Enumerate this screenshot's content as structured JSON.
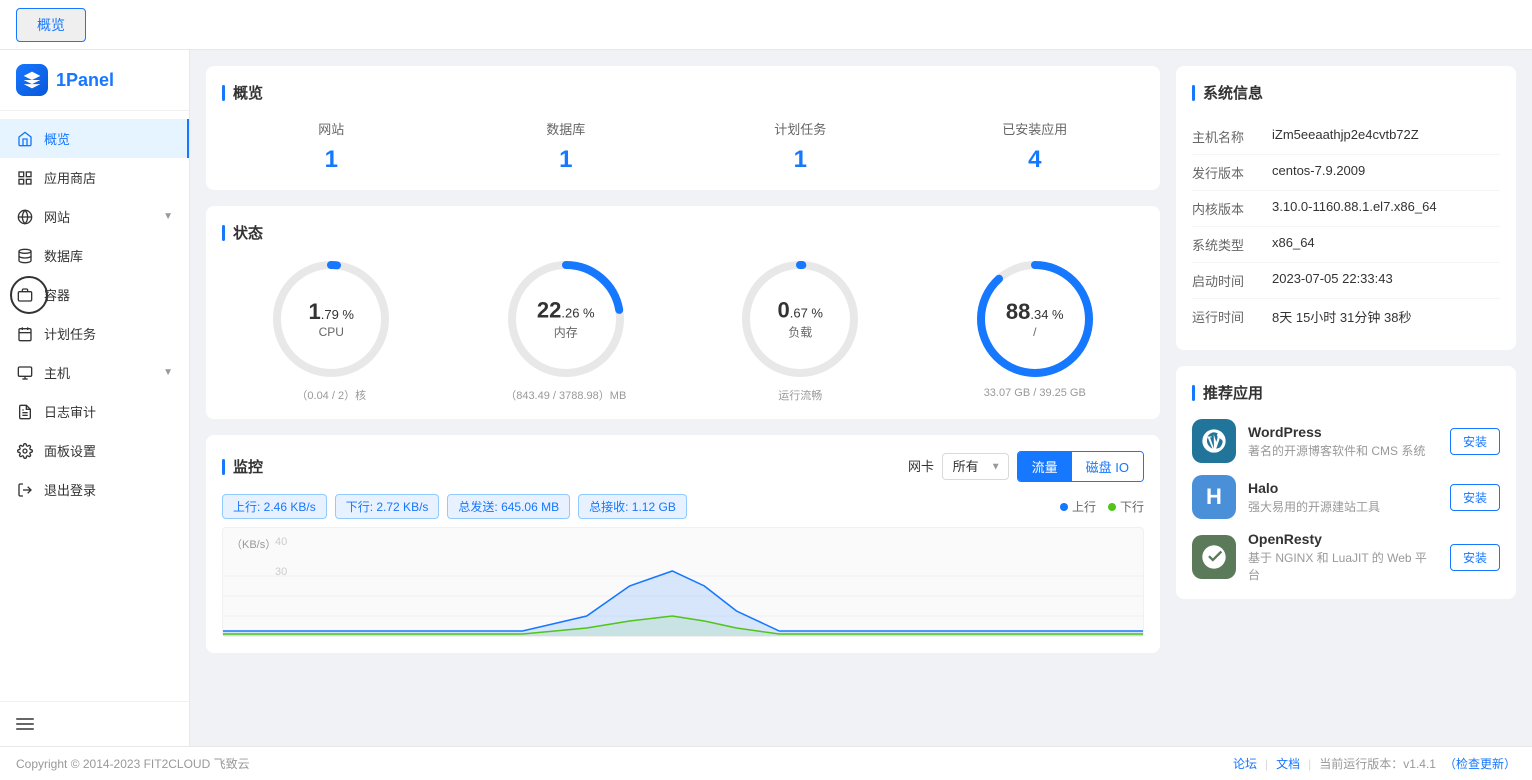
{
  "topbar": {
    "tab_label": "概览"
  },
  "sidebar": {
    "logo_text": "1Panel",
    "menu_items": [
      {
        "id": "overview",
        "label": "概览",
        "icon": "home-icon",
        "active": true
      },
      {
        "id": "appstore",
        "label": "应用商店",
        "icon": "grid-icon",
        "active": false
      },
      {
        "id": "website",
        "label": "网站",
        "icon": "globe-icon",
        "active": false,
        "has_arrow": true
      },
      {
        "id": "database",
        "label": "数据库",
        "icon": "database-icon",
        "active": false
      },
      {
        "id": "container",
        "label": "容器",
        "icon": "container-icon",
        "active": false
      },
      {
        "id": "crontask",
        "label": "计划任务",
        "icon": "calendar-icon",
        "active": false
      },
      {
        "id": "host",
        "label": "主机",
        "icon": "host-icon",
        "active": false,
        "has_arrow": true
      },
      {
        "id": "audit",
        "label": "日志审计",
        "icon": "audit-icon",
        "active": false
      },
      {
        "id": "settings",
        "label": "面板设置",
        "icon": "settings-icon",
        "active": false
      },
      {
        "id": "logout",
        "label": "退出登录",
        "icon": "logout-icon",
        "active": false
      }
    ]
  },
  "overview": {
    "section_title": "概览",
    "stats": [
      {
        "label": "网站",
        "value": "1"
      },
      {
        "label": "数据库",
        "value": "1"
      },
      {
        "label": "计划任务",
        "value": "1"
      },
      {
        "label": "已安装应用",
        "value": "4"
      }
    ]
  },
  "status": {
    "section_title": "状态",
    "gauges": [
      {
        "id": "cpu",
        "name": "CPU",
        "big_num": "1",
        "dot": ".",
        "small_num": "79",
        "unit": "%",
        "detail": "（0.04 / 2）核",
        "percent": 1.79,
        "color": "#1677ff",
        "circumference": 339.3,
        "dash_offset": 333.3
      },
      {
        "id": "memory",
        "name": "内存",
        "big_num": "22",
        "dot": ".",
        "small_num": "26",
        "unit": "%",
        "detail": "（843.49 / 3788.98）MB",
        "percent": 22.26,
        "color": "#1677ff",
        "circumference": 339.3,
        "dash_offset": 263.8
      },
      {
        "id": "load",
        "name": "负载",
        "big_num": "0",
        "dot": ".",
        "small_num": "67",
        "unit": "%",
        "detail": "运行流畅",
        "percent": 0.67,
        "color": "#1677ff",
        "circumference": 339.3,
        "dash_offset": 337.0
      },
      {
        "id": "disk",
        "name": "/",
        "big_num": "88",
        "dot": ".",
        "small_num": "34",
        "unit": "%",
        "detail": "33.07 GB / 39.25 GB",
        "percent": 88.34,
        "color": "#1677ff",
        "circumference": 339.3,
        "dash_offset": 39.7
      }
    ]
  },
  "monitor": {
    "section_title": "监控",
    "nic_label": "网卡",
    "nic_option": "所有",
    "tab_traffic": "流量",
    "tab_disk_io": "磁盘 IO",
    "stats": [
      {
        "label": "上行: 2.46 KB/s"
      },
      {
        "label": "下行: 2.72 KB/s"
      },
      {
        "label": "总发送: 645.06 MB"
      },
      {
        "label": "总接收: 1.12 GB"
      }
    ],
    "y_axis_label": "（KB/s）",
    "y_values": [
      "40",
      "30"
    ],
    "legend_up": "上行",
    "legend_down": "下行",
    "legend_up_color": "#1677ff",
    "legend_down_color": "#52c41a"
  },
  "system_info": {
    "section_title": "系统信息",
    "rows": [
      {
        "key": "主机名称",
        "value": "iZm5eeaathjp2e4cvtb72Z"
      },
      {
        "key": "发行版本",
        "value": "centos-7.9.2009"
      },
      {
        "key": "内核版本",
        "value": "3.10.0-1160.88.1.el7.x86_64"
      },
      {
        "key": "系统类型",
        "value": "x86_64"
      },
      {
        "key": "启动时间",
        "value": "2023-07-05 22:33:43"
      },
      {
        "key": "运行时间",
        "value": "8天 15小时 31分钟 38秒"
      }
    ]
  },
  "recommended_apps": {
    "section_title": "推荐应用",
    "apps": [
      {
        "id": "wordpress",
        "name": "WordPress",
        "desc": "著名的开源博客软件和 CMS 系统",
        "icon_text": "W",
        "icon_class": "wordpress",
        "install_label": "安装"
      },
      {
        "id": "halo",
        "name": "Halo",
        "desc": "强大易用的开源建站工具",
        "icon_text": "H",
        "icon_class": "halo",
        "install_label": "安装"
      },
      {
        "id": "openresty",
        "name": "OpenResty",
        "desc": "基于 NGINX 和 LuaJIT 的 Web 平台",
        "icon_text": "🦅",
        "icon_class": "openresty",
        "install_label": "安装"
      }
    ]
  },
  "footer": {
    "copyright": "Copyright © 2014-2023 FIT2CLOUD 飞致云",
    "links": [
      {
        "label": "论坛"
      },
      {
        "label": "文档"
      }
    ],
    "version_text": "当前运行版本：v1.4.1",
    "update_link": "（检查更新）"
  }
}
